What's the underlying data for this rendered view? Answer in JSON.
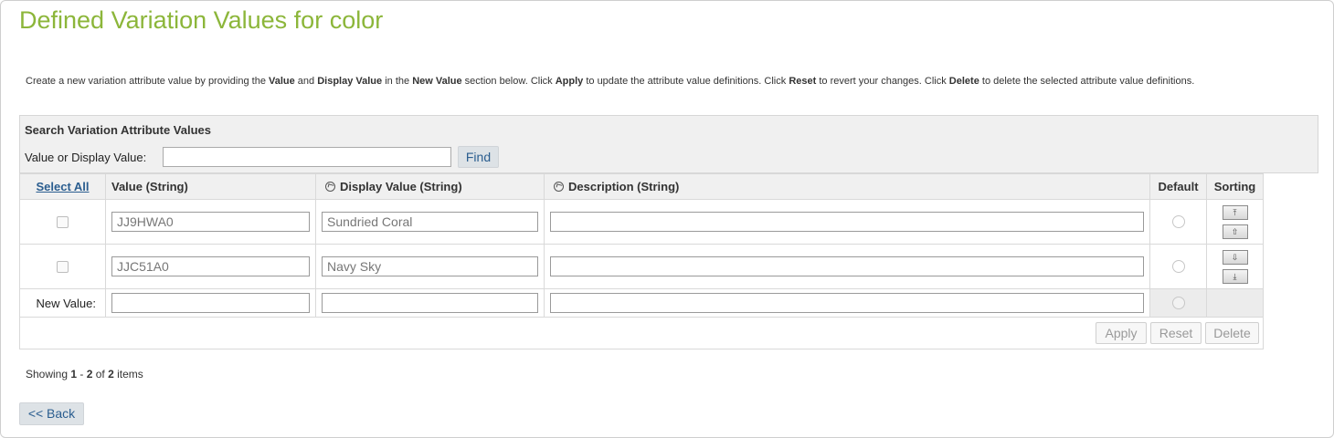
{
  "page": {
    "title": "Defined Variation Values for color",
    "intro": {
      "t1": "Create a new variation attribute value by providing the ",
      "b1": "Value",
      "t2": " and ",
      "b2": "Display Value",
      "t3": " in the ",
      "b3": "New Value",
      "t4": " section below. Click ",
      "b4": "Apply",
      "t5": " to update the attribute value definitions. Click ",
      "b5": "Reset",
      "t6": " to revert your changes. Click ",
      "b6": "Delete",
      "t7": " to delete the selected attribute value definitions."
    }
  },
  "search": {
    "heading": "Search Variation Attribute Values",
    "label": "Value or Display Value:",
    "value": "",
    "find_label": "Find"
  },
  "table": {
    "headers": {
      "select_all": "Select All",
      "value": "Value (String)",
      "display_value": "Display Value (String)",
      "description": "Description (String)",
      "default": "Default",
      "sorting": "Sorting"
    },
    "rows": [
      {
        "value": "JJ9HWA0",
        "display_value": "Sundried Coral",
        "description": ""
      },
      {
        "value": "JJC51A0",
        "display_value": "Navy Sky",
        "description": ""
      }
    ],
    "new_value_label": "New Value:",
    "sort_icons": [
      "move-top-icon",
      "move-up-icon",
      "move-down-icon",
      "move-bottom-icon"
    ],
    "actions": {
      "apply": "Apply",
      "reset": "Reset",
      "delete": "Delete"
    }
  },
  "pagination": {
    "prefix": "Showing ",
    "start": "1",
    "dash": " - ",
    "end": "2",
    "of": " of ",
    "total": "2",
    "suffix": " items"
  },
  "back_label": "<< Back",
  "colors": {
    "title": "#8cb63a",
    "link": "#2a5d8f"
  }
}
